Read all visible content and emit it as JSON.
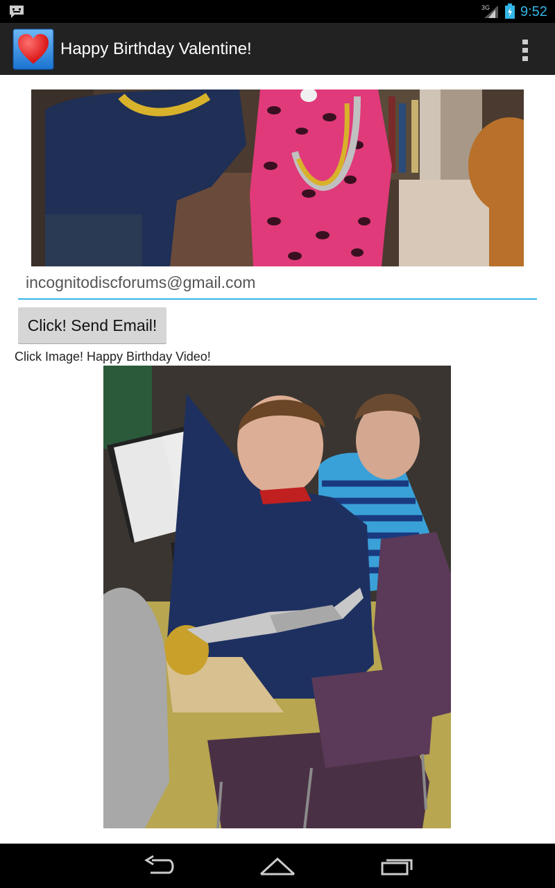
{
  "status_bar": {
    "time": "9:52",
    "network_type": "3G",
    "icons": [
      "message-icon",
      "signal-icon",
      "battery-charging-icon"
    ]
  },
  "action_bar": {
    "title": "Happy Birthday Valentine!",
    "app_icon": "heart-icon",
    "menu_icon": "overflow-menu-icon"
  },
  "content": {
    "top_photo": "photo-children-party",
    "email_value": "incognitodiscforums@gmail.com",
    "send_button_label": "Click! Send Email!",
    "caption": "Click Image! Happy Birthday Video!",
    "main_photo": "photo-boy-saxophone"
  },
  "nav_bar": {
    "icons": [
      "back-icon",
      "home-icon",
      "recent-apps-icon"
    ]
  },
  "colors": {
    "accent": "#33b5e5",
    "action_bar": "#222222",
    "button": "#d6d6d6"
  }
}
